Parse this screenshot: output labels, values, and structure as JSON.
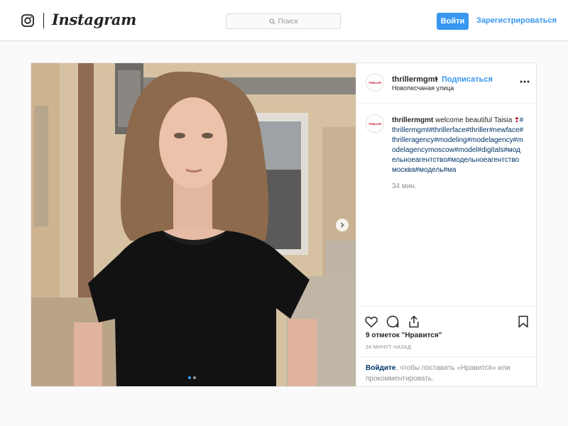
{
  "topbar": {
    "brand": "Instagram",
    "search_placeholder": "Поиск",
    "login_button": "Войти",
    "register_link": "Зарегистрироваться"
  },
  "post": {
    "username": "thrillermgmt",
    "separator": "•",
    "follow_label": "Подписаться",
    "location": "Новопесчаная улица",
    "avatar_logo_text": "THRILLER",
    "caption_user": "thrillermgmt",
    "caption_text": "welcome beautiful Taisia",
    "caption_heart": "❣",
    "caption_tags": "#thrillermgmt#thrillerface#thriller#newface#thrilleragency#modeling#modelagency#modelagencymoscow#model#digitals#модельноеагентство#модельноеагентствомосква#модель#ма",
    "caption_time": "34 мин.",
    "likes": "9 отметок \"Нравится\"",
    "time_ago": "34 МИНУТ НАЗАД",
    "login_prompt_link": "Войдите",
    "login_prompt_text": ", чтобы поставить «Нравится» или прокомментировать.",
    "carousel": {
      "total": 2,
      "active_index": 0
    }
  },
  "colors": {
    "accent": "#3897f0",
    "link_dark": "#003569",
    "brand_red": "#c0122d"
  },
  "icons": [
    "instagram-logo-icon",
    "search-icon",
    "more-options-icon",
    "chevron-right-icon",
    "heart-icon",
    "comment-icon",
    "share-icon",
    "bookmark-icon"
  ]
}
